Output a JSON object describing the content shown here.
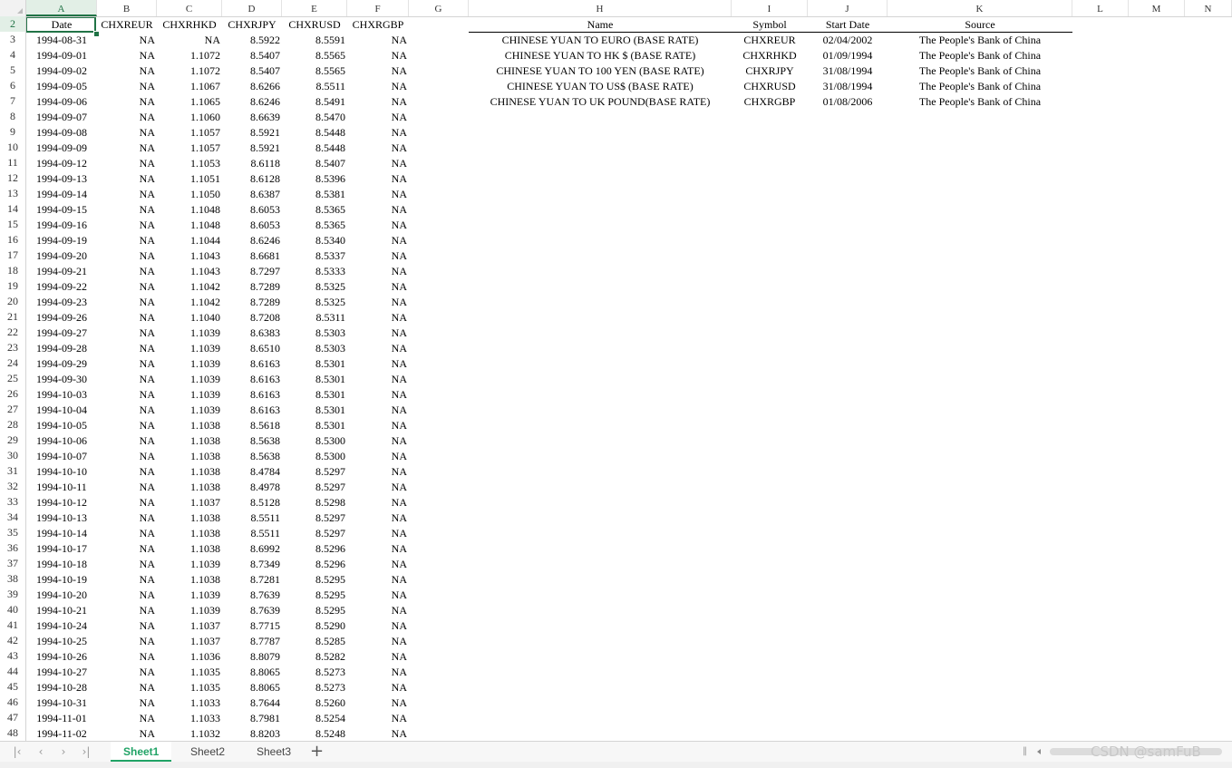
{
  "column_headers": [
    "A",
    "B",
    "C",
    "D",
    "E",
    "F",
    "G",
    "H",
    "I",
    "J",
    "K",
    "L",
    "M",
    "N"
  ],
  "header_row": {
    "row_num": "2",
    "cells": [
      "Date",
      "CHXREUR",
      "CHXRHKD",
      "CHXRJPY",
      "CHXRUSD",
      "CHXRGBP"
    ]
  },
  "rows": [
    {
      "n": "3",
      "date": "1994-08-31",
      "eur": "NA",
      "hkd": "NA",
      "jpy": "8.5922",
      "usd": "8.5591",
      "gbp": "NA"
    },
    {
      "n": "4",
      "date": "1994-09-01",
      "eur": "NA",
      "hkd": "1.1072",
      "jpy": "8.5407",
      "usd": "8.5565",
      "gbp": "NA"
    },
    {
      "n": "5",
      "date": "1994-09-02",
      "eur": "NA",
      "hkd": "1.1072",
      "jpy": "8.5407",
      "usd": "8.5565",
      "gbp": "NA"
    },
    {
      "n": "6",
      "date": "1994-09-05",
      "eur": "NA",
      "hkd": "1.1067",
      "jpy": "8.6266",
      "usd": "8.5511",
      "gbp": "NA"
    },
    {
      "n": "7",
      "date": "1994-09-06",
      "eur": "NA",
      "hkd": "1.1065",
      "jpy": "8.6246",
      "usd": "8.5491",
      "gbp": "NA"
    },
    {
      "n": "8",
      "date": "1994-09-07",
      "eur": "NA",
      "hkd": "1.1060",
      "jpy": "8.6639",
      "usd": "8.5470",
      "gbp": "NA"
    },
    {
      "n": "9",
      "date": "1994-09-08",
      "eur": "NA",
      "hkd": "1.1057",
      "jpy": "8.5921",
      "usd": "8.5448",
      "gbp": "NA"
    },
    {
      "n": "10",
      "date": "1994-09-09",
      "eur": "NA",
      "hkd": "1.1057",
      "jpy": "8.5921",
      "usd": "8.5448",
      "gbp": "NA"
    },
    {
      "n": "11",
      "date": "1994-09-12",
      "eur": "NA",
      "hkd": "1.1053",
      "jpy": "8.6118",
      "usd": "8.5407",
      "gbp": "NA"
    },
    {
      "n": "12",
      "date": "1994-09-13",
      "eur": "NA",
      "hkd": "1.1051",
      "jpy": "8.6128",
      "usd": "8.5396",
      "gbp": "NA"
    },
    {
      "n": "13",
      "date": "1994-09-14",
      "eur": "NA",
      "hkd": "1.1050",
      "jpy": "8.6387",
      "usd": "8.5381",
      "gbp": "NA"
    },
    {
      "n": "14",
      "date": "1994-09-15",
      "eur": "NA",
      "hkd": "1.1048",
      "jpy": "8.6053",
      "usd": "8.5365",
      "gbp": "NA"
    },
    {
      "n": "15",
      "date": "1994-09-16",
      "eur": "NA",
      "hkd": "1.1048",
      "jpy": "8.6053",
      "usd": "8.5365",
      "gbp": "NA"
    },
    {
      "n": "16",
      "date": "1994-09-19",
      "eur": "NA",
      "hkd": "1.1044",
      "jpy": "8.6246",
      "usd": "8.5340",
      "gbp": "NA"
    },
    {
      "n": "17",
      "date": "1994-09-20",
      "eur": "NA",
      "hkd": "1.1043",
      "jpy": "8.6681",
      "usd": "8.5337",
      "gbp": "NA"
    },
    {
      "n": "18",
      "date": "1994-09-21",
      "eur": "NA",
      "hkd": "1.1043",
      "jpy": "8.7297",
      "usd": "8.5333",
      "gbp": "NA"
    },
    {
      "n": "19",
      "date": "1994-09-22",
      "eur": "NA",
      "hkd": "1.1042",
      "jpy": "8.7289",
      "usd": "8.5325",
      "gbp": "NA"
    },
    {
      "n": "20",
      "date": "1994-09-23",
      "eur": "NA",
      "hkd": "1.1042",
      "jpy": "8.7289",
      "usd": "8.5325",
      "gbp": "NA"
    },
    {
      "n": "21",
      "date": "1994-09-26",
      "eur": "NA",
      "hkd": "1.1040",
      "jpy": "8.7208",
      "usd": "8.5311",
      "gbp": "NA"
    },
    {
      "n": "22",
      "date": "1994-09-27",
      "eur": "NA",
      "hkd": "1.1039",
      "jpy": "8.6383",
      "usd": "8.5303",
      "gbp": "NA"
    },
    {
      "n": "23",
      "date": "1994-09-28",
      "eur": "NA",
      "hkd": "1.1039",
      "jpy": "8.6510",
      "usd": "8.5303",
      "gbp": "NA"
    },
    {
      "n": "24",
      "date": "1994-09-29",
      "eur": "NA",
      "hkd": "1.1039",
      "jpy": "8.6163",
      "usd": "8.5301",
      "gbp": "NA"
    },
    {
      "n": "25",
      "date": "1994-09-30",
      "eur": "NA",
      "hkd": "1.1039",
      "jpy": "8.6163",
      "usd": "8.5301",
      "gbp": "NA"
    },
    {
      "n": "26",
      "date": "1994-10-03",
      "eur": "NA",
      "hkd": "1.1039",
      "jpy": "8.6163",
      "usd": "8.5301",
      "gbp": "NA"
    },
    {
      "n": "27",
      "date": "1994-10-04",
      "eur": "NA",
      "hkd": "1.1039",
      "jpy": "8.6163",
      "usd": "8.5301",
      "gbp": "NA"
    },
    {
      "n": "28",
      "date": "1994-10-05",
      "eur": "NA",
      "hkd": "1.1038",
      "jpy": "8.5618",
      "usd": "8.5301",
      "gbp": "NA"
    },
    {
      "n": "29",
      "date": "1994-10-06",
      "eur": "NA",
      "hkd": "1.1038",
      "jpy": "8.5638",
      "usd": "8.5300",
      "gbp": "NA"
    },
    {
      "n": "30",
      "date": "1994-10-07",
      "eur": "NA",
      "hkd": "1.1038",
      "jpy": "8.5638",
      "usd": "8.5300",
      "gbp": "NA"
    },
    {
      "n": "31",
      "date": "1994-10-10",
      "eur": "NA",
      "hkd": "1.1038",
      "jpy": "8.4784",
      "usd": "8.5297",
      "gbp": "NA"
    },
    {
      "n": "32",
      "date": "1994-10-11",
      "eur": "NA",
      "hkd": "1.1038",
      "jpy": "8.4978",
      "usd": "8.5297",
      "gbp": "NA"
    },
    {
      "n": "33",
      "date": "1994-10-12",
      "eur": "NA",
      "hkd": "1.1037",
      "jpy": "8.5128",
      "usd": "8.5298",
      "gbp": "NA"
    },
    {
      "n": "34",
      "date": "1994-10-13",
      "eur": "NA",
      "hkd": "1.1038",
      "jpy": "8.5511",
      "usd": "8.5297",
      "gbp": "NA"
    },
    {
      "n": "35",
      "date": "1994-10-14",
      "eur": "NA",
      "hkd": "1.1038",
      "jpy": "8.5511",
      "usd": "8.5297",
      "gbp": "NA"
    },
    {
      "n": "36",
      "date": "1994-10-17",
      "eur": "NA",
      "hkd": "1.1038",
      "jpy": "8.6992",
      "usd": "8.5296",
      "gbp": "NA"
    },
    {
      "n": "37",
      "date": "1994-10-18",
      "eur": "NA",
      "hkd": "1.1039",
      "jpy": "8.7349",
      "usd": "8.5296",
      "gbp": "NA"
    },
    {
      "n": "38",
      "date": "1994-10-19",
      "eur": "NA",
      "hkd": "1.1038",
      "jpy": "8.7281",
      "usd": "8.5295",
      "gbp": "NA"
    },
    {
      "n": "39",
      "date": "1994-10-20",
      "eur": "NA",
      "hkd": "1.1039",
      "jpy": "8.7639",
      "usd": "8.5295",
      "gbp": "NA"
    },
    {
      "n": "40",
      "date": "1994-10-21",
      "eur": "NA",
      "hkd": "1.1039",
      "jpy": "8.7639",
      "usd": "8.5295",
      "gbp": "NA"
    },
    {
      "n": "41",
      "date": "1994-10-24",
      "eur": "NA",
      "hkd": "1.1037",
      "jpy": "8.7715",
      "usd": "8.5290",
      "gbp": "NA"
    },
    {
      "n": "42",
      "date": "1994-10-25",
      "eur": "NA",
      "hkd": "1.1037",
      "jpy": "8.7787",
      "usd": "8.5285",
      "gbp": "NA"
    },
    {
      "n": "43",
      "date": "1994-10-26",
      "eur": "NA",
      "hkd": "1.1036",
      "jpy": "8.8079",
      "usd": "8.5282",
      "gbp": "NA"
    },
    {
      "n": "44",
      "date": "1994-10-27",
      "eur": "NA",
      "hkd": "1.1035",
      "jpy": "8.8065",
      "usd": "8.5273",
      "gbp": "NA"
    },
    {
      "n": "45",
      "date": "1994-10-28",
      "eur": "NA",
      "hkd": "1.1035",
      "jpy": "8.8065",
      "usd": "8.5273",
      "gbp": "NA"
    },
    {
      "n": "46",
      "date": "1994-10-31",
      "eur": "NA",
      "hkd": "1.1033",
      "jpy": "8.7644",
      "usd": "8.5260",
      "gbp": "NA"
    },
    {
      "n": "47",
      "date": "1994-11-01",
      "eur": "NA",
      "hkd": "1.1033",
      "jpy": "8.7981",
      "usd": "8.5254",
      "gbp": "NA"
    },
    {
      "n": "48",
      "date": "1994-11-02",
      "eur": "NA",
      "hkd": "1.1032",
      "jpy": "8.8203",
      "usd": "8.5248",
      "gbp": "NA"
    }
  ],
  "lookup_table": {
    "headers": [
      "Name",
      "Symbol",
      "Start Date",
      "Source"
    ],
    "rows": [
      {
        "name": "CHINESE YUAN TO EURO (BASE RATE)",
        "symbol": "CHXREUR",
        "start": "02/04/2002",
        "source": "The People's Bank of China"
      },
      {
        "name": "CHINESE YUAN TO HK $ (BASE RATE)",
        "symbol": "CHXRHKD",
        "start": "01/09/1994",
        "source": "The People's Bank of China"
      },
      {
        "name": "CHINESE YUAN TO 100 YEN (BASE RATE)",
        "symbol": "CHXRJPY",
        "start": "31/08/1994",
        "source": "The People's Bank of China"
      },
      {
        "name": "CHINESE YUAN TO US$ (BASE RATE)",
        "symbol": "CHXRUSD",
        "start": "31/08/1994",
        "source": "The People's Bank of China"
      },
      {
        "name": "CHINESE YUAN TO UK POUND(BASE RATE)",
        "symbol": "CHXRGBP",
        "start": "01/08/2006",
        "source": "The People's Bank of China"
      }
    ]
  },
  "sheet_tabs": [
    "Sheet1",
    "Sheet2",
    "Sheet3"
  ],
  "active_sheet": "Sheet1",
  "add_sheet_label": "+",
  "nav_icons": [
    "first-sheet-icon",
    "prev-sheet-icon",
    "next-sheet-icon",
    "last-sheet-icon"
  ],
  "watermark": "CSDN @samFuB",
  "colors": {
    "accent": "#217346",
    "tab_active": "#21a366",
    "header_bg": "#f2f2f2"
  }
}
